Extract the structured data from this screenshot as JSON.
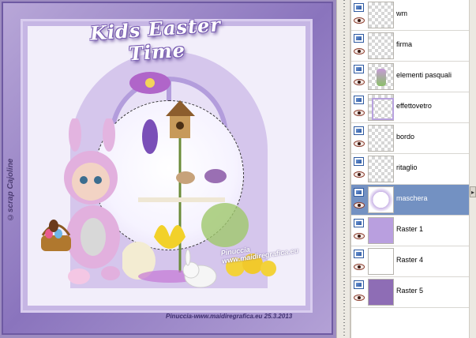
{
  "canvas": {
    "title_text": "Kids Easter Time",
    "side_credit": "©scrap Cajoline",
    "bottom_credit": "Pinuccia-www.maidiregrafica.eu 25.3.2013",
    "inline_watermark": "Pinuccia www.maidiregrafica.eu"
  },
  "layers": [
    {
      "name": "wm",
      "thumb": "transparent"
    },
    {
      "name": "firma",
      "thumb": "transparent"
    },
    {
      "name": "elementi pasquali",
      "thumb": "easter"
    },
    {
      "name": "effettovetro",
      "thumb": "glass"
    },
    {
      "name": "bordo",
      "thumb": "transparent"
    },
    {
      "name": "ritaglio",
      "thumb": "transparent"
    },
    {
      "name": "maschera",
      "thumb": "mask",
      "selected": true
    },
    {
      "name": "Raster 1",
      "thumb": "lilac"
    },
    {
      "name": "Raster 4",
      "thumb": "white"
    },
    {
      "name": "Raster 5",
      "thumb": "purple"
    }
  ],
  "scroll": {
    "arrow": "▸"
  }
}
